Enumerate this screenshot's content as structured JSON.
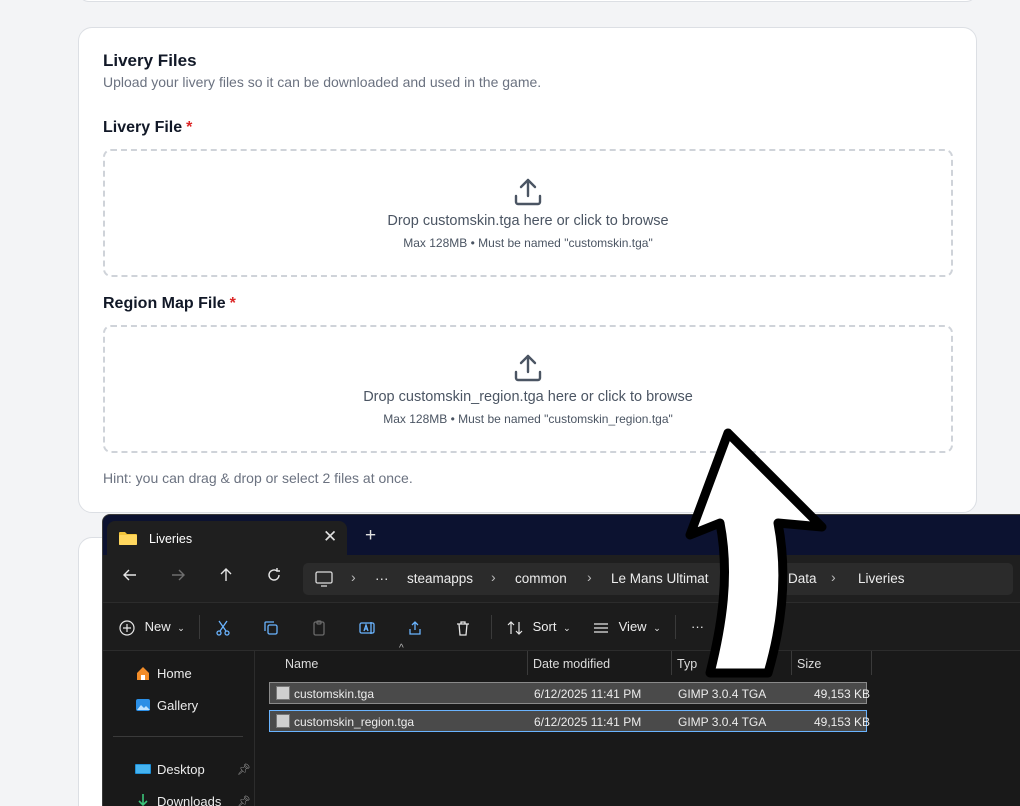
{
  "form": {
    "title": "Livery Files",
    "subtitle": "Upload your livery files so it can be downloaded and used in the game.",
    "livery_file": {
      "label": "Livery File",
      "required_mark": "*",
      "drop_text": "Drop customskin.tga here or click to browse",
      "constraint_text": "Max 128MB • Must be named \"customskin.tga\""
    },
    "region_map_file": {
      "label": "Region Map File",
      "required_mark": "*",
      "drop_text": "Drop customskin_region.tga here or click to browse",
      "constraint_text": "Max 128MB • Must be named \"customskin_region.tga\""
    },
    "hint": "Hint: you can drag & drop or select 2 files at once."
  },
  "explorer": {
    "tab_title": "Liveries",
    "close_glyph": "✕",
    "new_tab_glyph": "+",
    "breadcrumb": [
      "steamapps",
      "common",
      "Le Mans Ultimat",
      "Data",
      "Liveries"
    ],
    "breadcrumb_more": "···",
    "toolbar": {
      "new_label": "New",
      "sort_label": "Sort",
      "view_label": "View",
      "more_glyph": "···"
    },
    "sidebar": [
      {
        "label": "Home",
        "icon": "home-icon",
        "pinned": false
      },
      {
        "label": "Gallery",
        "icon": "gallery-icon",
        "pinned": false
      },
      {
        "label": "Desktop",
        "icon": "desktop-icon",
        "pinned": true
      },
      {
        "label": "Downloads",
        "icon": "downloads-icon",
        "pinned": true
      }
    ],
    "columns": {
      "name": "Name",
      "date_modified": "Date modified",
      "type": "Typ",
      "size": "Size"
    },
    "files": [
      {
        "name": "customskin.tga",
        "date_modified": "6/12/2025 11:41 PM",
        "type": "GIMP 3.0.4 TGA",
        "size": "49,153 KB"
      },
      {
        "name": "customskin_region.tga",
        "date_modified": "6/12/2025 11:41 PM",
        "type": "GIMP 3.0.4 TGA",
        "size": "49,153 KB"
      }
    ]
  },
  "colors": {
    "required": "#dc2626",
    "explorer_bg": "#191919",
    "explorer_titlebar": "#0c1230",
    "selected_row": "#4a4a4a"
  }
}
